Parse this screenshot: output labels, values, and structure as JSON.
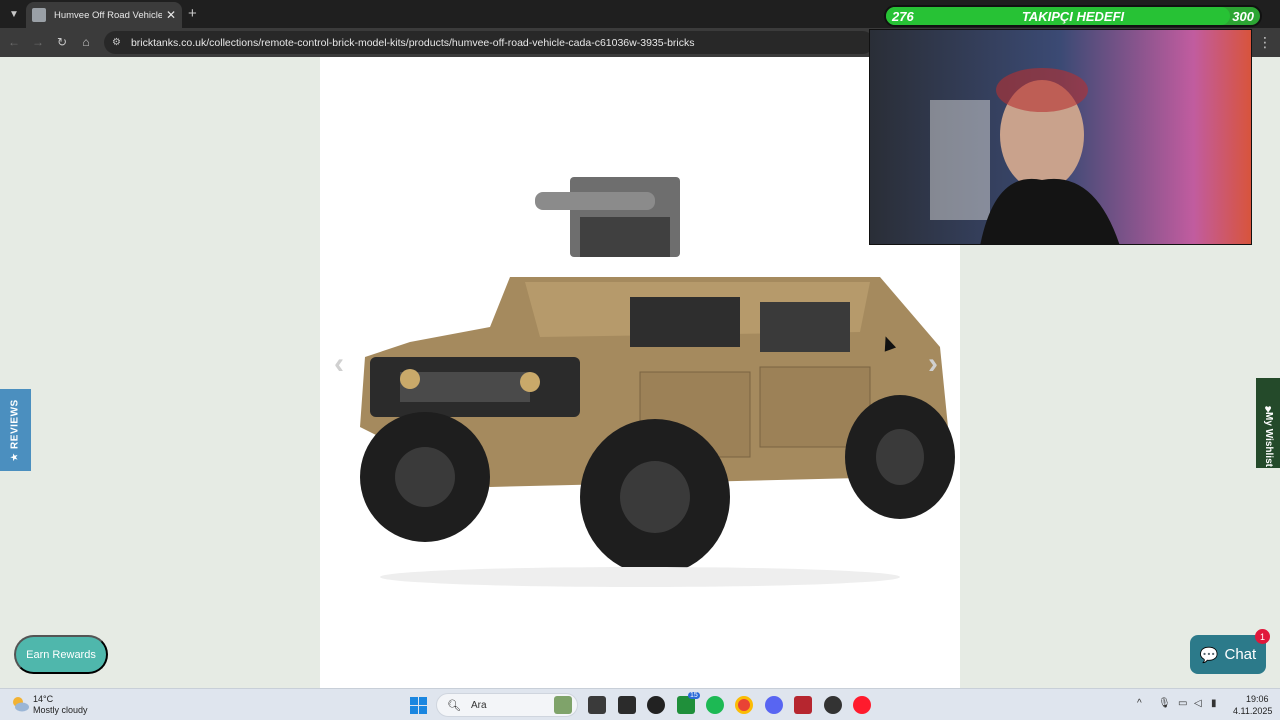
{
  "browser": {
    "tab_title": "Humvee Off Road Vehicle RC b",
    "url": "bricktanks.co.uk/collections/remote-control-brick-model-kits/products/humvee-off-road-vehicle-cada-c61036w-3935-bricks"
  },
  "page": {
    "reviews_label": "★ REVIEWS",
    "wishlist_label": "My Wishlist",
    "earn_rewards_label": "Earn Rewards",
    "chat_label": "Chat",
    "chat_badge": "1"
  },
  "overlay": {
    "goal_current": "276",
    "goal_title": "TAKIPÇI HEDEFI",
    "goal_target": "300",
    "goal_progress": 0.92
  },
  "taskbar": {
    "weather_temp": "14°C",
    "weather_desc": "Mostly cloudy",
    "search_placeholder": "Ara",
    "time": "19:06",
    "date": "4.11.2025",
    "discord_badge": "15"
  },
  "colors": {
    "page_bg": "#e6ebe4",
    "reviews_tab": "#4b8fbf",
    "wishlist_tab": "#244a2a",
    "earn_rewards": "#4fb7ac",
    "chat": "#2c7a8a",
    "goal_bar": "#27c235"
  }
}
